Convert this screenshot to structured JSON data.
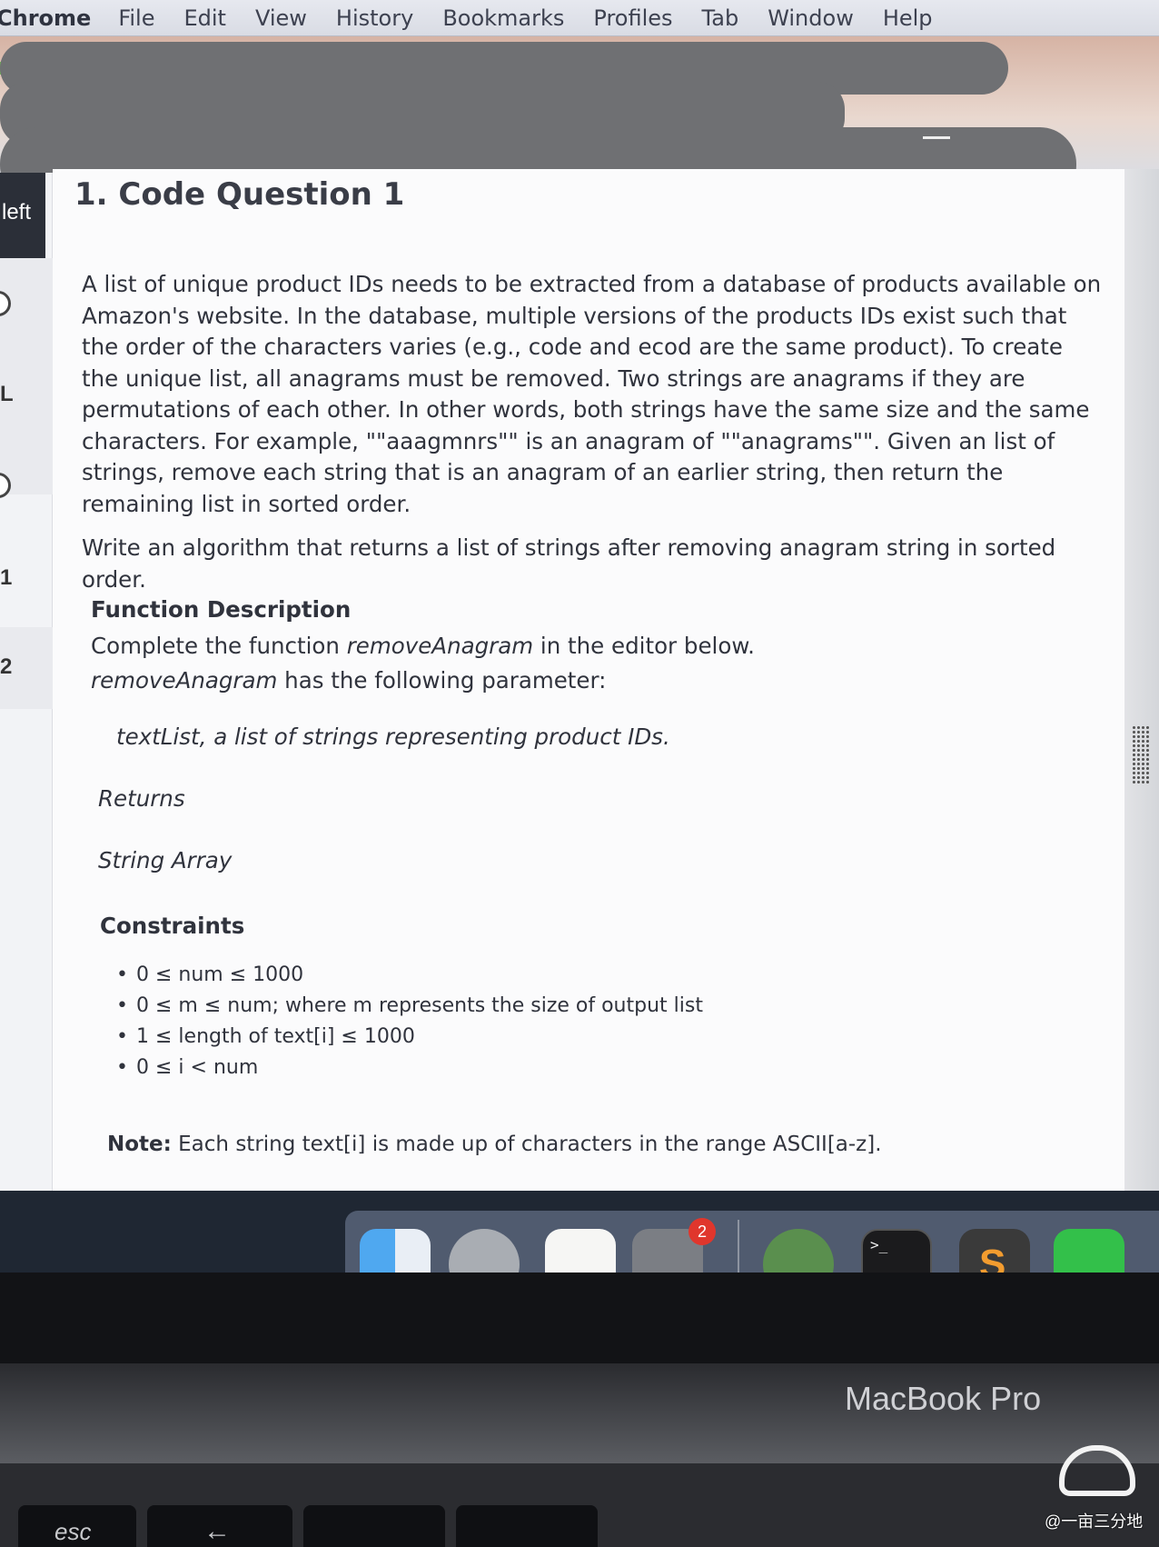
{
  "menubar": {
    "app": "Chrome",
    "items": [
      "File",
      "Edit",
      "View",
      "History",
      "Bookmarks",
      "Profiles",
      "Tab",
      "Window",
      "Help"
    ]
  },
  "sidebar": {
    "active_label": "left",
    "labels": [
      "L",
      "1",
      "2"
    ]
  },
  "question": {
    "title": "1. Code Question 1",
    "para1": "A list of unique product IDs needs to be extracted from a database of products available on Amazon's website. In the database, multiple versions of the products IDs exist such that the order of the characters varies (e.g., code and ecod are the same product). To create the unique list, all anagrams must be removed. Two strings are anagrams if they are permutations of each other. In other words, both strings have the same size and the same characters. For example, \"\"aaagmnrs\"\" is an anagram of \"\"anagrams\"\". Given an list of strings, remove each string that is an anagram of an earlier string, then return the remaining list in sorted order.",
    "para2": "Write an algorithm that returns a list of strings after removing anagram string in sorted order.",
    "function_heading": "Function Description",
    "fd_prefix": "Complete the function ",
    "fd_name": "removeAnagram",
    "fd_suffix": " in the editor below.",
    "fd2_name": "removeAnagram",
    "fd2_suffix": " has the following parameter:",
    "parameter": "textList, a list of strings representing product IDs.",
    "returns_heading": "Returns",
    "returns_value": "String Array",
    "constraints_heading": "Constraints",
    "constraints": [
      "0 ≤ num ≤ 1000",
      "0 ≤ m ≤ num; where m represents the size of output list",
      "1 ≤ length of text[i] ≤ 1000",
      "0 ≤ i < num"
    ],
    "note_label": "Note:",
    "note_text": " Each string text[i] is made up of characters in the range ASCII[a-z]."
  },
  "dock": {
    "badge_count": "2",
    "terminal_prompt": ">_",
    "icons": [
      "finder-icon",
      "launchpad-icon",
      "reminders-icon",
      "system-preferences-icon",
      "network-app-icon",
      "terminal-icon",
      "sublime-text-icon",
      "wechat-icon"
    ]
  },
  "hardware": {
    "brand": "MacBook Pro",
    "esc_key": "esc",
    "back_key": "←"
  },
  "watermark": "@一亩三分地"
}
